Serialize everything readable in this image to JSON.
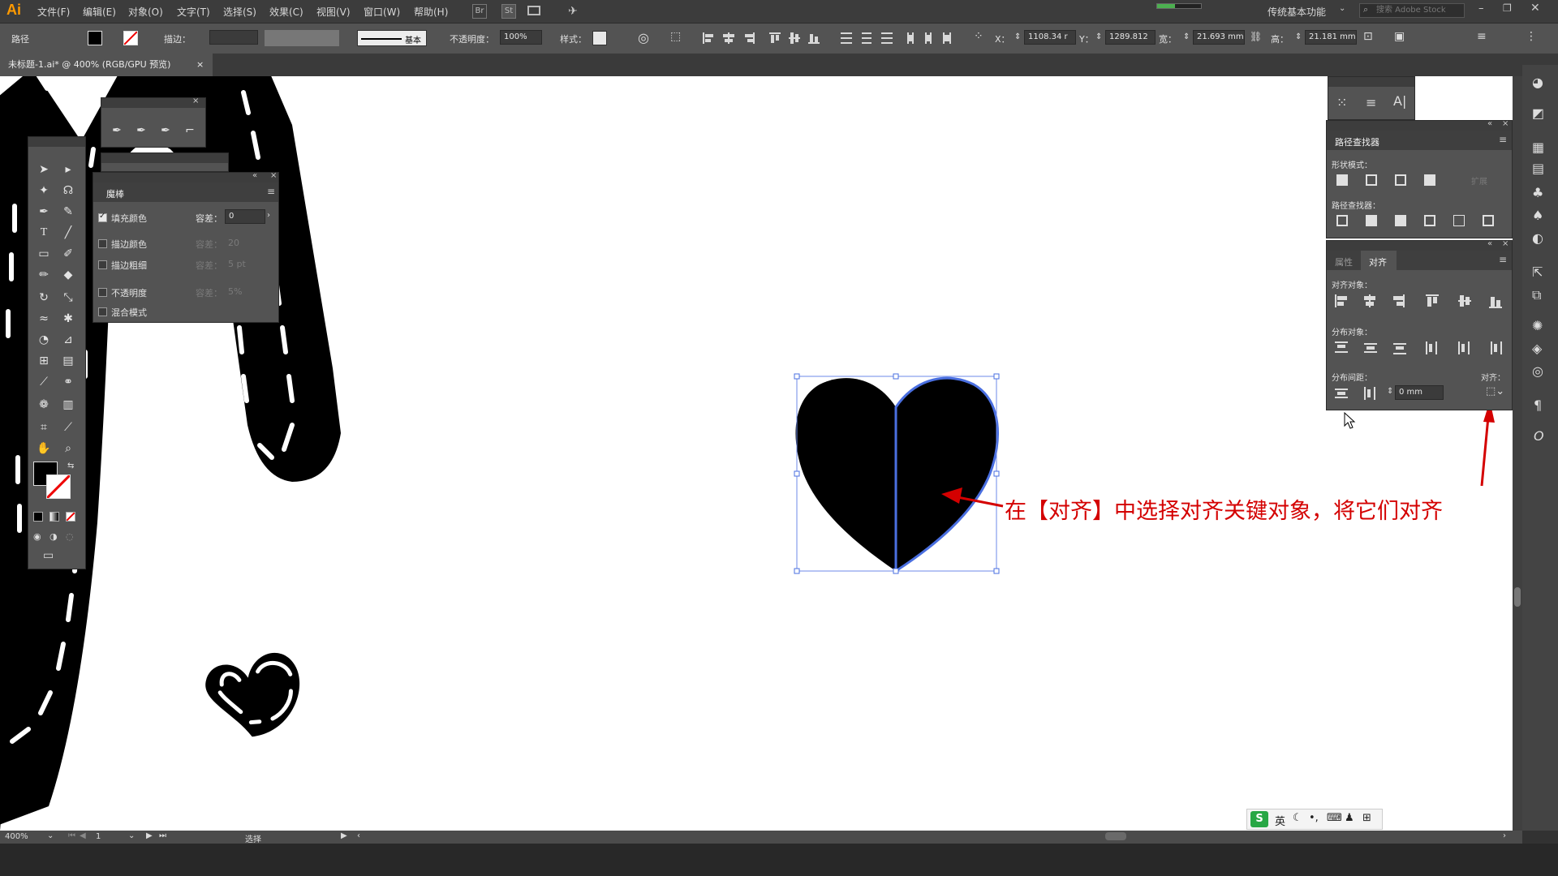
{
  "app": {
    "logo": "Ai",
    "workspace": "传统基本功能",
    "search_placeholder": "搜索 Adobe Stock"
  },
  "menu": [
    "文件(F)",
    "编辑(E)",
    "对象(O)",
    "文字(T)",
    "选择(S)",
    "效果(C)",
    "视图(V)",
    "窗口(W)",
    "帮助(H)"
  ],
  "menu_icons": {
    "bridge": "Br",
    "stock": "St"
  },
  "controlbar": {
    "selection_label": "路径",
    "stroke_label": "描边：",
    "stroke_style": "基本",
    "opacity_label": "不透明度：",
    "opacity_value": "100%",
    "style_label": "样式：",
    "x_label": "X：",
    "x_value": "1108.34 r",
    "y_label": "Y：",
    "y_value": "1289.812",
    "w_label": "宽：",
    "w_value": "21.693 mm",
    "h_label": "高：",
    "h_value": "21.181 mm"
  },
  "doc_tab": {
    "title": "未标题-1.ai* @ 400% (RGB/GPU 预览)",
    "close": "×"
  },
  "magic_wand_panel": {
    "title": "魔棒",
    "tolerance_label": "容差：",
    "rows": [
      {
        "label": "填充颜色",
        "checked": true,
        "value": "0",
        "enabled": true
      },
      {
        "label": "描边颜色",
        "checked": false,
        "value": "20",
        "enabled": false
      },
      {
        "label": "描边粗细",
        "checked": false,
        "value": "5 pt",
        "enabled": false
      },
      {
        "label": "不透明度",
        "checked": false,
        "value": "5%",
        "enabled": false
      },
      {
        "label": "混合模式",
        "checked": false,
        "value": "",
        "enabled": false
      }
    ]
  },
  "pathfinder_panel": {
    "title": "路径查找器",
    "shape_modes_label": "形状模式：",
    "expand_label": "扩展",
    "pathfinders_label": "路径查找器："
  },
  "align_panel": {
    "tab_properties": "属性",
    "tab_align": "对齐",
    "align_objects_label": "对齐对象：",
    "distribute_objects_label": "分布对象：",
    "distribute_spacing_label": "分布间距：",
    "align_to_label": "对齐：",
    "spacing_value": "0 mm"
  },
  "annotation": {
    "text": "在【对齐】中选择对齐关键对象，将它们对齐"
  },
  "statusbar": {
    "zoom": "400%",
    "page": "1",
    "tool": "选择"
  },
  "ime": {
    "lang": "英"
  },
  "colors": {
    "accent_red": "#d40000",
    "selection_blue": "#4a6fe0",
    "logo_orange": "#ff9a00"
  }
}
